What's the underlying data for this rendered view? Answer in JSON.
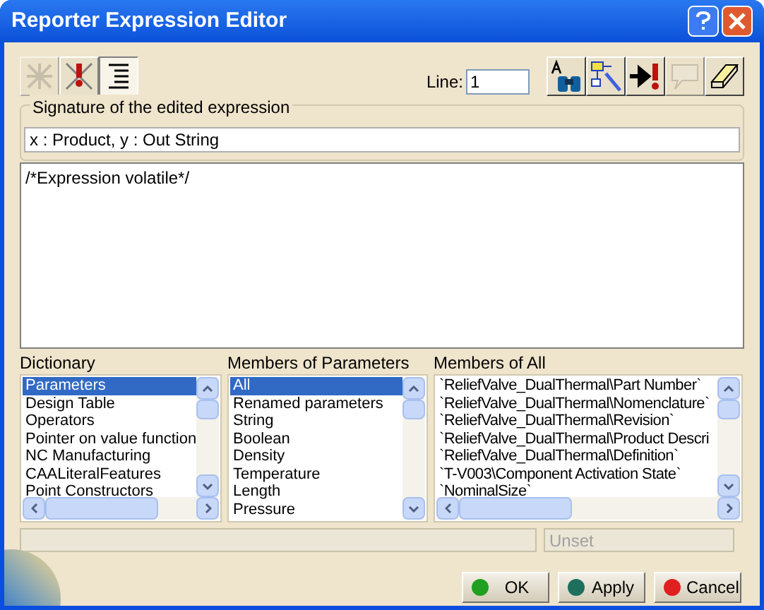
{
  "window": {
    "title": "Reporter Expression Editor"
  },
  "left_tools": [
    {
      "pressed": false,
      "disabled": true
    },
    {
      "pressed": false,
      "disabled": false
    },
    {
      "pressed": true,
      "disabled": false
    }
  ],
  "line": {
    "label": "Line:",
    "value": "1"
  },
  "right_tools": [
    {
      "disabled": false
    },
    {
      "disabled": false
    },
    {
      "disabled": false
    },
    {
      "disabled": true
    },
    {
      "disabled": false
    }
  ],
  "signature": {
    "label": "Signature of the edited expression",
    "value": "x : Product, y : Out String"
  },
  "expression": {
    "value": "/*Expression volatile*/"
  },
  "lists": [
    {
      "title": "Dictionary",
      "items": [
        {
          "text": "Parameters",
          "selected": true
        },
        {
          "text": "Design Table",
          "selected": false
        },
        {
          "text": "Operators",
          "selected": false
        },
        {
          "text": "Pointer on value function",
          "selected": false
        },
        {
          "text": "NC Manufacturing",
          "selected": false
        },
        {
          "text": "CAALiteralFeatures",
          "selected": false
        },
        {
          "text": "Point Constructors",
          "selected": false
        }
      ]
    },
    {
      "title": "Members of Parameters",
      "items": [
        {
          "text": "All",
          "selected": true
        },
        {
          "text": "Renamed parameters",
          "selected": false
        },
        {
          "text": "String",
          "selected": false
        },
        {
          "text": "Boolean",
          "selected": false
        },
        {
          "text": "Density",
          "selected": false
        },
        {
          "text": "Temperature",
          "selected": false
        },
        {
          "text": "Length",
          "selected": false
        },
        {
          "text": "Pressure",
          "selected": false
        }
      ]
    },
    {
      "title": "Members of All",
      "items": [
        {
          "text": "`ReliefValve_DualThermal\\Part Number`",
          "selected": false
        },
        {
          "text": "`ReliefValve_DualThermal\\Nomenclature`",
          "selected": false
        },
        {
          "text": "`ReliefValve_DualThermal\\Revision`",
          "selected": false
        },
        {
          "text": "`ReliefValve_DualThermal\\Product Descri",
          "selected": false
        },
        {
          "text": "`ReliefValve_DualThermal\\Definition`",
          "selected": false
        },
        {
          "text": "`T-V003\\Component Activation State`",
          "selected": false
        },
        {
          "text": "`NominalSize`",
          "selected": false
        }
      ]
    }
  ],
  "status": {
    "value": "Unset"
  },
  "buttons": [
    {
      "label": "OK",
      "color": "#20a020"
    },
    {
      "label": "Apply",
      "color": "#1f6f5f"
    },
    {
      "label": "Cancel",
      "color": "#e02020"
    }
  ]
}
